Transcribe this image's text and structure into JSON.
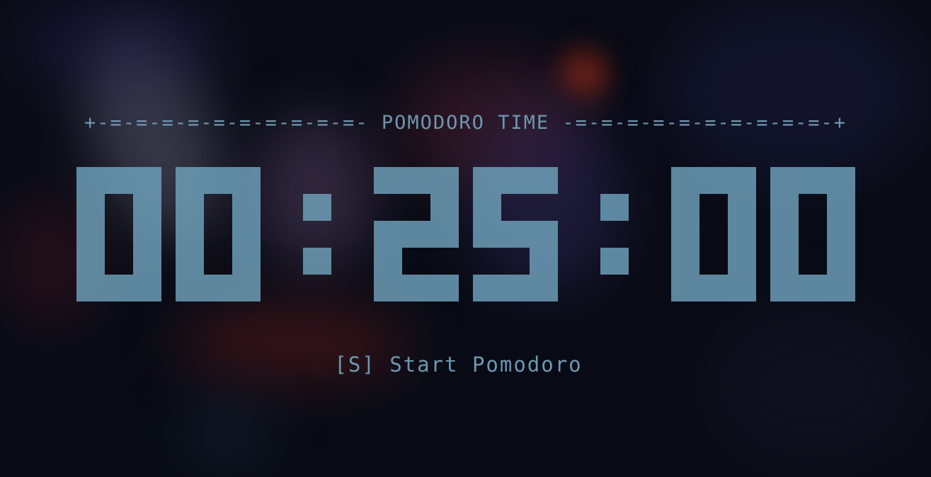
{
  "app": {
    "header_text": "+-=-=-=-=-=-=-=-=-=-=- POMODORO TIME -=-=-=-=-=-=-=-=-=-=-+"
  },
  "timer": {
    "display": "00:25:00",
    "hours": "00",
    "minutes": "25",
    "seconds": "00"
  },
  "controls": {
    "start_label": "[S] Start Pomodoro"
  },
  "colors": {
    "accent": "#6e97b0",
    "digits": "#6ea0b9",
    "background": "#0a0c16"
  }
}
